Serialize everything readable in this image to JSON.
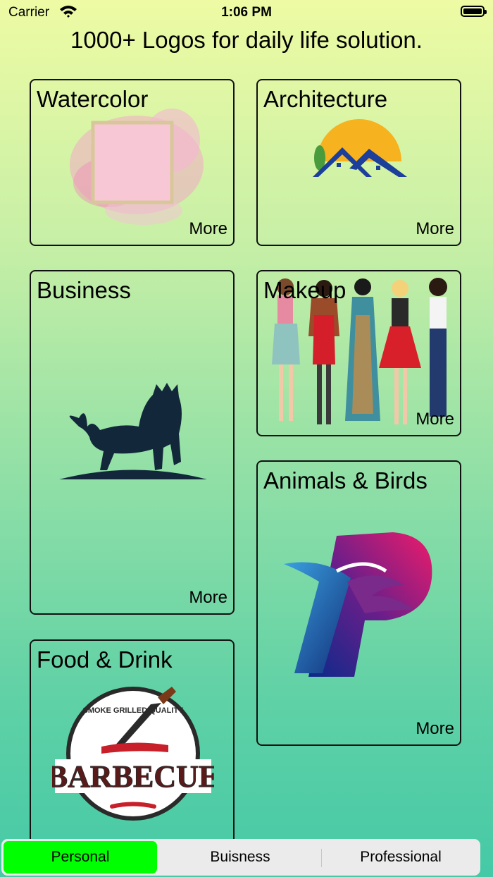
{
  "status_bar": {
    "carrier": "Carrier",
    "time": "1:06 PM"
  },
  "page_title": "1000+ Logos for daily life solution.",
  "cards": {
    "watercolor": {
      "title": "Watercolor",
      "more": "More"
    },
    "architecture": {
      "title": "Architecture",
      "more": "More"
    },
    "business": {
      "title": "Business",
      "more": "More"
    },
    "makeup": {
      "title": "Makeup",
      "more": "More"
    },
    "animals": {
      "title": "Animals & Birds",
      "more": "More"
    },
    "food": {
      "title": "Food & Drink"
    }
  },
  "food_logo": {
    "arc_text": "SMOKE GRILLED QUALITY",
    "word": "BARBECUE"
  },
  "segments": [
    {
      "label": "Personal",
      "selected": true
    },
    {
      "label": "Buisness",
      "selected": false
    },
    {
      "label": "Professional",
      "selected": false
    }
  ],
  "colors": {
    "selected_segment": "#00ff00",
    "segment_track": "#ebebeb"
  }
}
